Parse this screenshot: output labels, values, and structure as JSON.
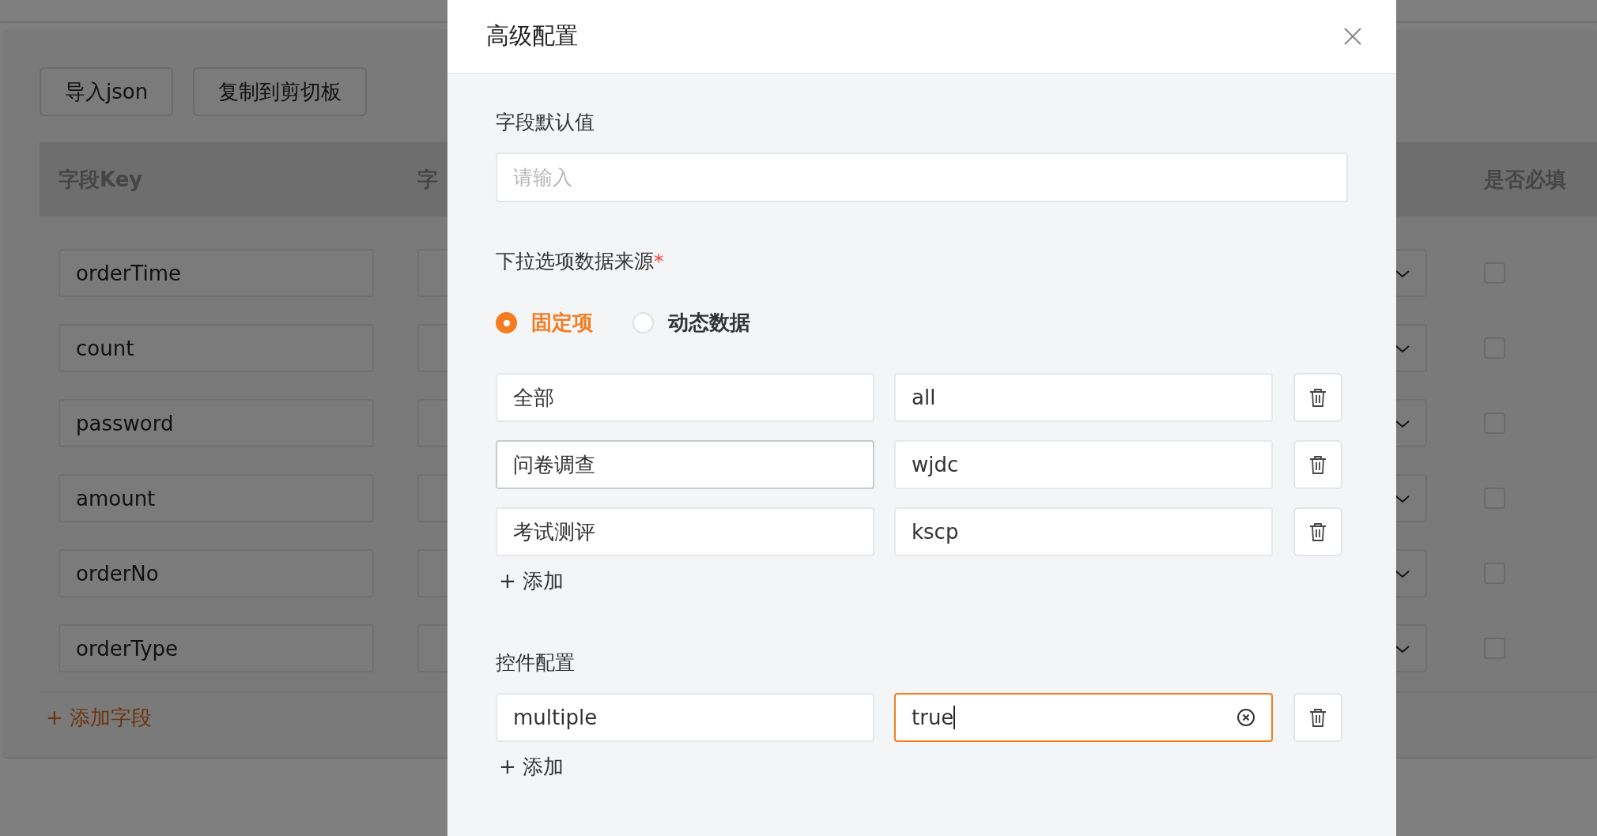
{
  "toolbar": {
    "buttons": [
      "导入json",
      "复制到剪切板"
    ]
  },
  "table": {
    "columns": [
      "字段Key",
      "字",
      "是否必填"
    ],
    "rows": [
      {
        "key": "orderTime",
        "required": false
      },
      {
        "key": "count",
        "required": false
      },
      {
        "key": "password",
        "required": false
      },
      {
        "key": "amount",
        "required": false
      },
      {
        "key": "orderNo",
        "required": false
      },
      {
        "key": "orderType",
        "required": false
      }
    ]
  },
  "add_field": "+ 添加字段",
  "dialog": {
    "title": "高级配置",
    "default_value": {
      "label": "字段默认值",
      "placeholder": "请输入"
    },
    "source": {
      "label": "下拉选项数据来源",
      "required_mark": "*",
      "options": [
        {
          "label": "固定项",
          "selected": true
        },
        {
          "label": "动态数据",
          "selected": false
        }
      ],
      "items": [
        {
          "label": "全部",
          "value": "all",
          "hovered": false
        },
        {
          "label": "问卷调查",
          "value": "wjdc",
          "hovered": true
        },
        {
          "label": "考试测评",
          "value": "kscp",
          "hovered": false
        }
      ],
      "add": "+ 添加"
    },
    "control_config": {
      "label": "控件配置",
      "items": [
        {
          "key": "multiple",
          "value": "true",
          "focused": true
        }
      ],
      "add": "+ 添加"
    }
  }
}
